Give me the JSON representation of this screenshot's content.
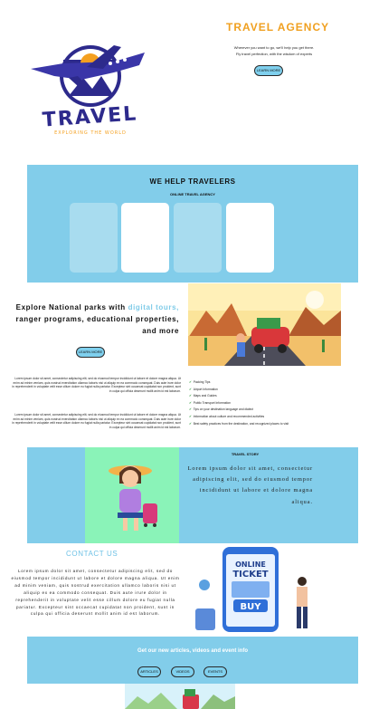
{
  "hero": {
    "logo_text": "TRAVEL",
    "logo_subtext": "EXPLORING THE WORLD",
    "title": "TRAVEL  AGENCY",
    "line1": "Wherever you want to go, we'll help you get there.",
    "line2": "Fly travel perfection, with the wisdom of experts",
    "button": "LEARN MORE"
  },
  "help": {
    "title": "WE HELP TRAVELERS",
    "subtitle": "ONLINE TRAVEL AGENCY"
  },
  "explore": {
    "text_part1": "Explore National parks with ",
    "highlight": "digital tours,",
    "text_part2": " ranger programs, educational properties, and more",
    "button": "LEARN MORE",
    "para1": "Lorem ipsum dolor sit amet, consectetur adipiscing elit, sed do eiusmod tempor incididunt ut labore et dolore magna aliqua. Ut enim ad minim veniam, quis nostrud exercitation ullamco laboris nisi ut aliquip ex ea commodo consequat. Duis aute irure dolor in reprehenderit in voluptate velit esse cillum dolore eu fugiat nulla pariatur. Excepteur sint occaecat cupidatat non proident, sunt in culpa qui officia deserunt mollit anim id est laborum.",
    "para2": "Lorem ipsum dolor sit amet, consectetur adipiscing elit, sed do eiusmod tempor incididunt ut labore et dolore magna aliqua. Ut enim ad minim veniam, quis nostrud exercitation ullamco laboris nisi ut aliquip ex ea commodo consequat. Duis aute irure dolor in reprehenderit in voluptate velit esse cillum dolore eu fugiat nulla pariatur. Excepteur sint occaecat cupidatat non proident, sunt in culpa qui officia deserunt mollit anim id est laborum.",
    "checklist": [
      "Packing Tips",
      "Airport Information",
      "Maps and Guides",
      "Public Transport Information",
      "Tips on your destination language and dialect",
      "Information about culture and recommended activities",
      "Best safety practices from the destination, and recognized places to visit"
    ]
  },
  "story": {
    "title": "TRAVEL STORY",
    "text": "Lorem ipsum dolor sit amet, consectetur adipiscing elit, sed do eiusmod tempor incididunt ut labore et dolore magna aliqua."
  },
  "contact": {
    "title": "CONTACT US",
    "text": "Lorem ipsum dolor sit amet, consectetur adipiscing elit, sed do eiusmod tempor incididunt ut labore et dolore magna aliqua. Ut enim ad minim veniam, quis nostrud exercitation ullamco laboris nisi ut aliquip ex ea commodo consequat. Duis aute irure dolor in reprehenderit in voluptate velit esse cillum dolore eu fugiat nulla pariatur. Excepteur sint occaecat cupidatat non proident, sunt in culpa qui officia deserunt mollit anim id est laborum.",
    "ticket_line1": "ONLINE",
    "ticket_line2": "TICKET",
    "ticket_buy": "BUY"
  },
  "newsletter": {
    "title": "Get our new articles, videos and event info",
    "buttons": [
      "ARTICLES",
      "VIDEOS",
      "EVENTS"
    ]
  },
  "colors": {
    "accent_blue": "#82cdea",
    "accent_orange": "#f0a020",
    "accent_green": "#8af3b8"
  }
}
